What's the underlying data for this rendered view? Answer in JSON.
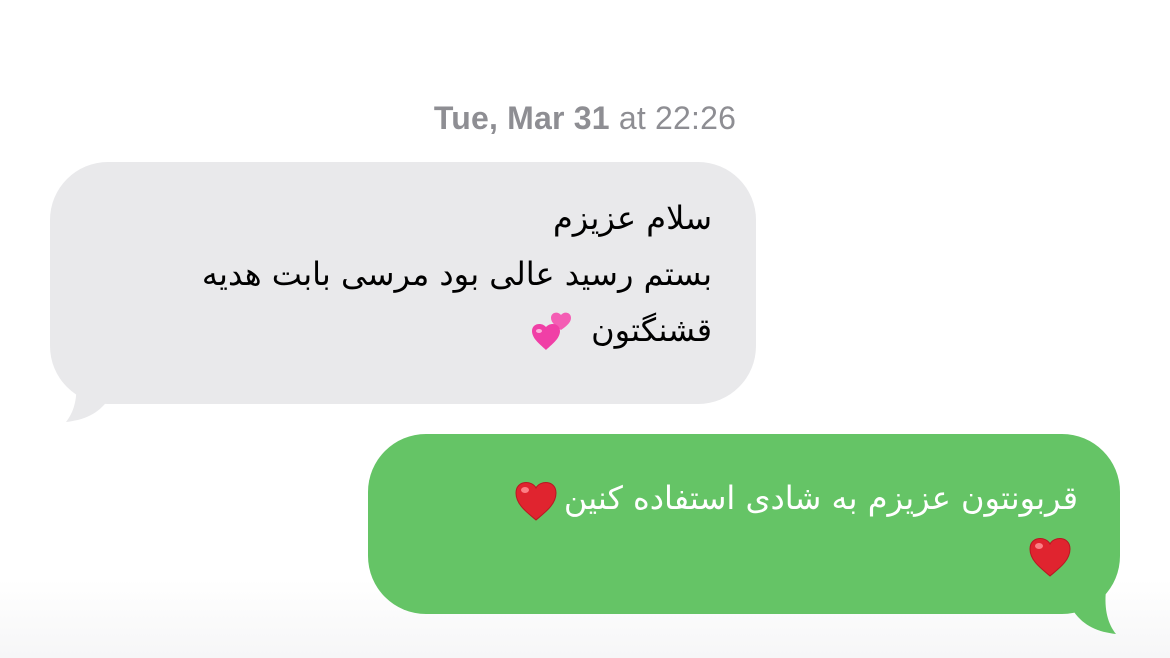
{
  "conversation": {
    "timestamp": {
      "date": "Tue, Mar 31",
      "at": "at",
      "time": "22:26"
    },
    "messages": [
      {
        "direction": "incoming",
        "lines": [
          "سلام عزیزم",
          "بستم رسید عالی بود مرسی بابت هدیه",
          "قشنگتون"
        ],
        "emoji": "two-hearts-icon",
        "bubble_color": "#e9e9eb",
        "text_color": "#000000"
      },
      {
        "direction": "outgoing",
        "lines": [
          "قربونتون عزیزم به شادی استفاده کنین"
        ],
        "emoji": "red-heart-icon",
        "bubble_color": "#65c466",
        "text_color": "#ffffff"
      }
    ]
  }
}
